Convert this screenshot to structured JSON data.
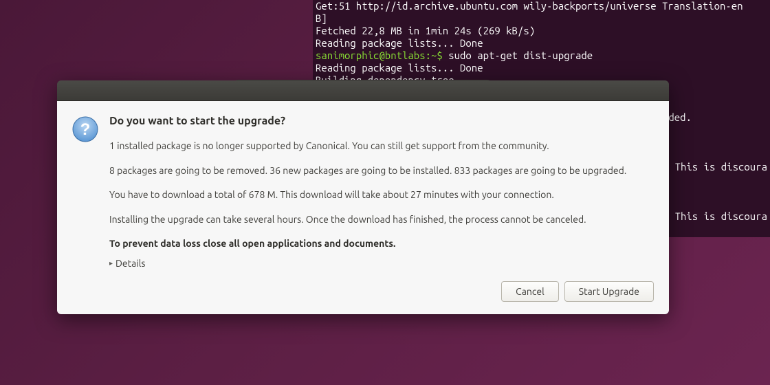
{
  "terminal": {
    "line1": "Get:51 http://id.archive.ubuntu.com wily-backports/universe Translation-en",
    "line2": "B]",
    "line3": "Fetched 22,8 MB in 1min 24s (269 kB/s)",
    "line4": "Reading package lists... Done",
    "prompt": "sanimorphic@bntlabs:~$ ",
    "cmd": "sudo apt-get dist-upgrade",
    "line6": "Reading package lists... Done",
    "line7": "Building dependency tree",
    "blank": "",
    "line8_suffix": "aded.",
    "line9_suffix": " This is discoura",
    "line10_suffix": " This is discoura"
  },
  "dialog": {
    "title": "Do you want to start the upgrade?",
    "p1": "1 installed package is no longer supported by Canonical. You can still get support from the community.",
    "p2": "8 packages are going to be removed. 36 new packages are going to be installed. 833 packages are going to be upgraded.",
    "p3": "You have to download a total of 678 M. This download will take about 27 minutes with your connection.",
    "p4": "Installing the upgrade can take several hours. Once the download has finished, the process cannot be canceled.",
    "p5": "To prevent data loss close all open applications and documents.",
    "details_label": "Details",
    "cancel_label": "Cancel",
    "start_label": "Start Upgrade"
  }
}
